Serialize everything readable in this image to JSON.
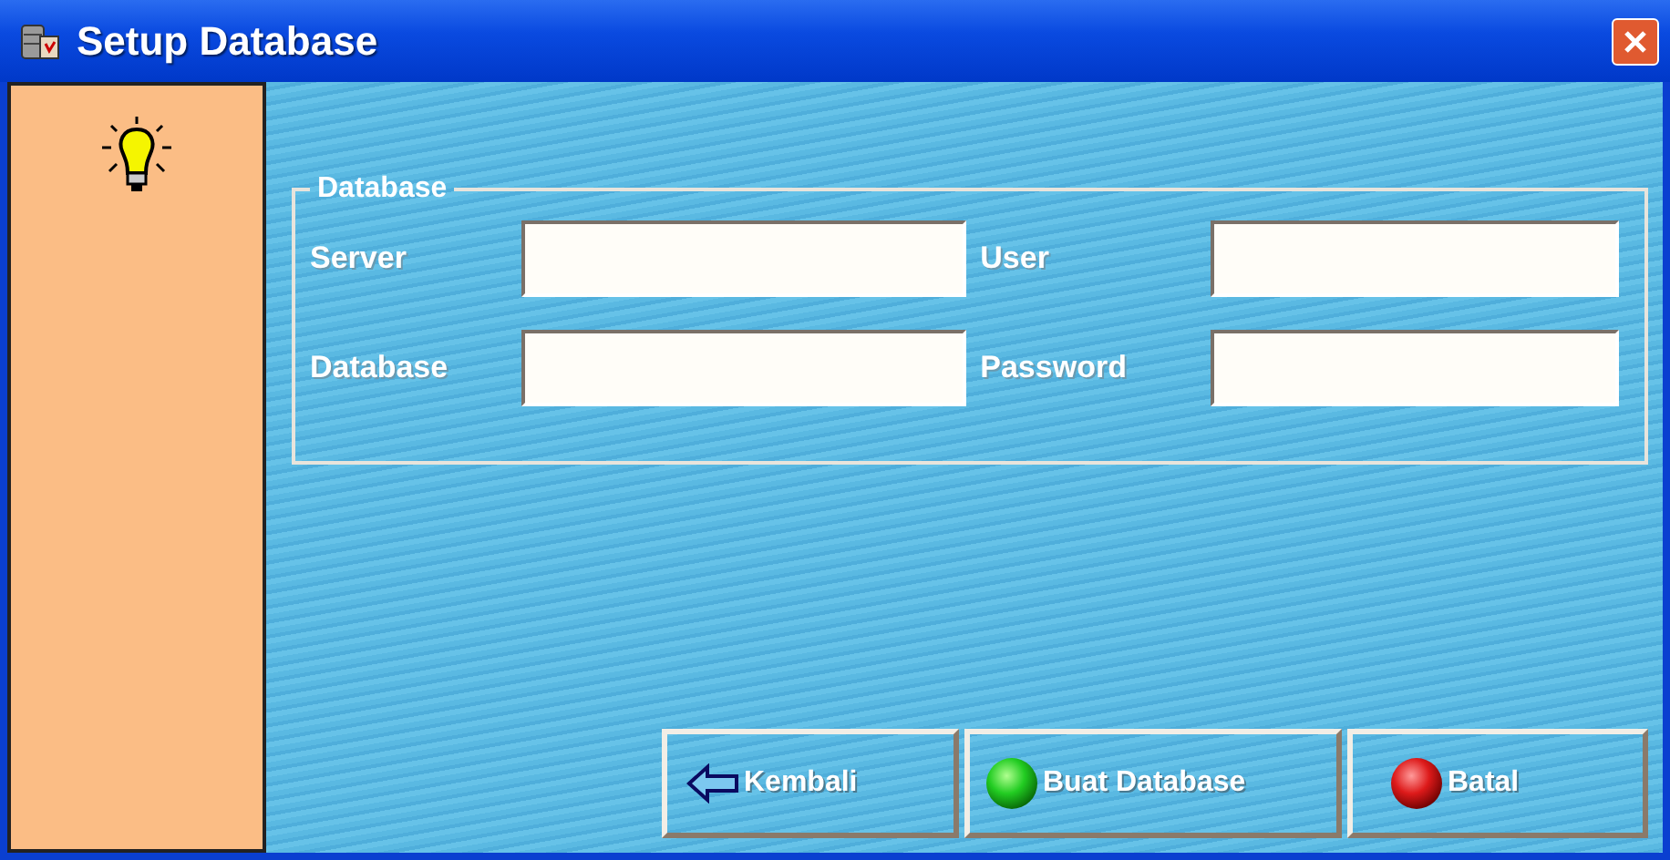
{
  "window": {
    "title": "Setup Database"
  },
  "group": {
    "title": "Database",
    "fields": [
      {
        "label": "Server"
      },
      {
        "label": "User"
      },
      {
        "label": "Database"
      },
      {
        "label": "Password"
      }
    ]
  },
  "buttons": [
    {
      "label": "Kembali",
      "kind": "back"
    },
    {
      "label": "Buat Database",
      "kind": "create"
    },
    {
      "label": "Batal",
      "kind": "cancel"
    }
  ]
}
